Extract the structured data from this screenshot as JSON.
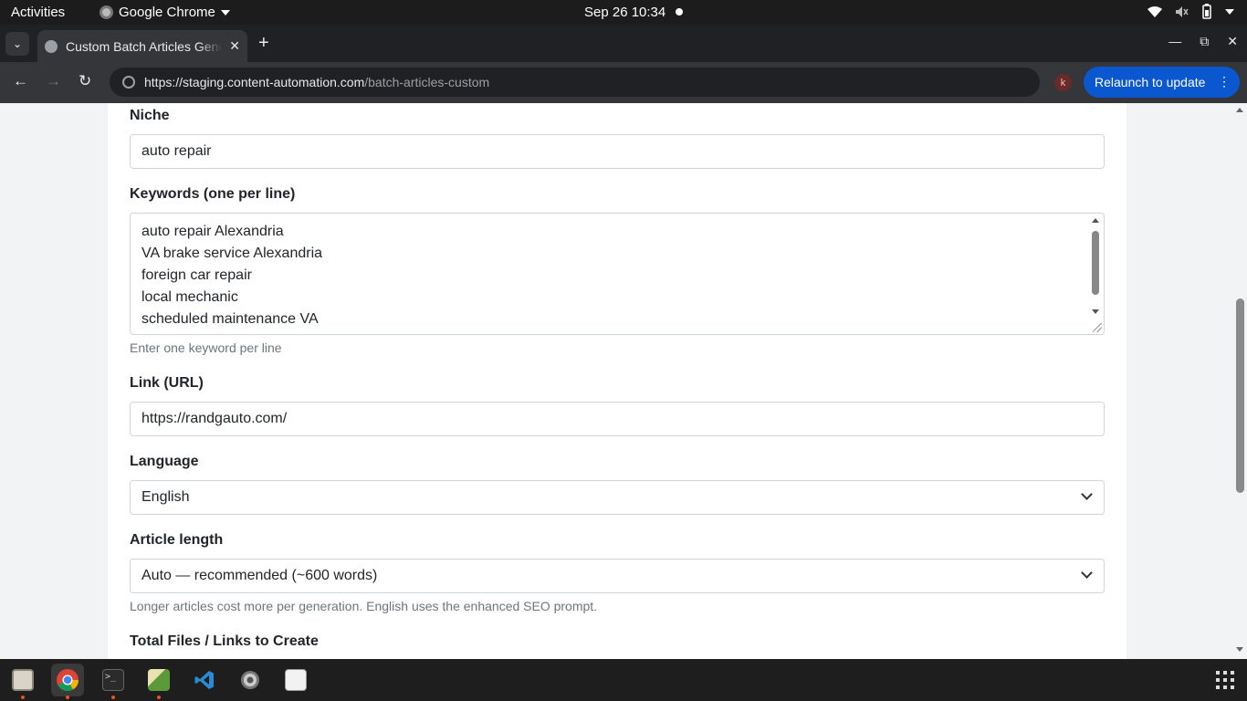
{
  "system_bar": {
    "activities": "Activities",
    "app_name": "Google Chrome",
    "clock": "Sep 26  10:34"
  },
  "browser": {
    "tab_title": "Custom Batch Articles Generator",
    "url_host": "https://staging.content-automation.com",
    "url_path": "/batch-articles-custom",
    "profile_initial": "k",
    "relaunch_label": "Relaunch to update"
  },
  "form": {
    "niche": {
      "label": "Niche",
      "value": "auto repair"
    },
    "keywords": {
      "label": "Keywords (one per line)",
      "lines": [
        "auto repair Alexandria",
        "VA brake service Alexandria",
        "foreign car repair",
        "local mechanic",
        "scheduled maintenance VA"
      ],
      "help": "Enter one keyword per line"
    },
    "link": {
      "label": "Link (URL)",
      "value": "https://randgauto.com/"
    },
    "language": {
      "label": "Language",
      "value": "English"
    },
    "article_length": {
      "label": "Article length",
      "value": "Auto — recommended (~600 words)",
      "help": "Longer articles cost more per generation. English uses the enhanced SEO prompt."
    },
    "total_files": {
      "label": "Total Files / Links to Create"
    }
  },
  "dock": {
    "items": [
      "files-icon",
      "chrome-icon",
      "terminal-icon",
      "image-editor-icon",
      "vscode-icon",
      "settings-icon",
      "app-icon"
    ]
  }
}
